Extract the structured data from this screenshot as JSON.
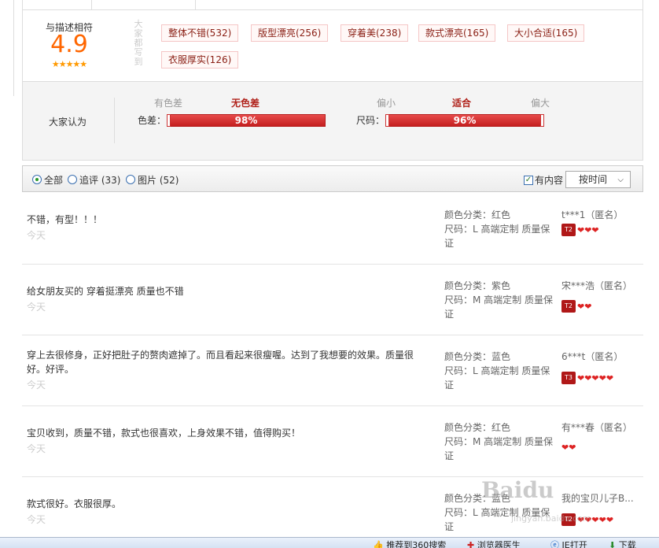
{
  "rating": {
    "label": "与描述相符",
    "score": "4.9",
    "stars": "★★★★★",
    "side_label": "大家都写到",
    "tags": [
      "整体不错(532)",
      "版型漂亮(256)",
      "穿着美(238)",
      "款式漂亮(165)",
      "大小合适(165)",
      "衣服厚实(126)"
    ]
  },
  "fit": {
    "label": "大家认为",
    "color_diff": {
      "name": "色差：",
      "left": "有色差",
      "middle": "无色差",
      "percent": "98%"
    },
    "size": {
      "name": "尺码：",
      "left": "偏小",
      "middle": "适合",
      "right": "偏大",
      "percent": "96%"
    }
  },
  "filter": {
    "all": "全部",
    "followup": "追评 (33)",
    "pictures": "图片 (52)",
    "has_content": "有内容",
    "sort": "按时间",
    "checkmark": "✓",
    "arrow": "⌵"
  },
  "reviews": [
    {
      "text": "不错，有型！！！",
      "date": "今天",
      "color": "颜色分类：红色",
      "size": "尺码：L 高端定制 质量保证",
      "user": "t***1（匿名）",
      "level": "T2",
      "hearts": "❤❤❤"
    },
    {
      "text": "给女朋友买的 穿着挺漂亮 质量也不错",
      "date": "今天",
      "color": "颜色分类：紫色",
      "size": "尺码：M 高端定制 质量保证",
      "user": "宋***浩（匿名）",
      "level": "T2",
      "hearts": "❤❤"
    },
    {
      "text": "穿上去很修身，正好把肚子的赘肉遮掉了。而且看起来很瘦喔。达到了我想要的效果。质量很好。好评。",
      "date": "今天",
      "color": "颜色分类：蓝色",
      "size": "尺码：L 高端定制 质量保证",
      "user": "6***t（匿名）",
      "level": "T3",
      "hearts": "❤❤❤❤❤"
    },
    {
      "text": "宝贝收到，质量不错，款式也很喜欢，上身效果不错，值得购买！",
      "date": "今天",
      "color": "颜色分类：红色",
      "size": "尺码：M 高端定制 质量保证",
      "user": "有***春（匿名）",
      "level": "",
      "hearts": "❤❤"
    },
    {
      "text": "款式很好。衣服很厚。",
      "date": "今天",
      "color": "颜色分类：蓝色",
      "size": "尺码：L 高端定制 质量保证",
      "user": "我的宝贝儿子B...",
      "level": "T2",
      "hearts": "❤❤❤❤❤"
    }
  ],
  "statusbar": {
    "recommend": "推荐到360搜索",
    "doctor": "浏览器医生",
    "ie": "IE打开",
    "download": "下载"
  },
  "watermark": {
    "main": "Baidu",
    "sub": "jingyan.baidu.com"
  }
}
